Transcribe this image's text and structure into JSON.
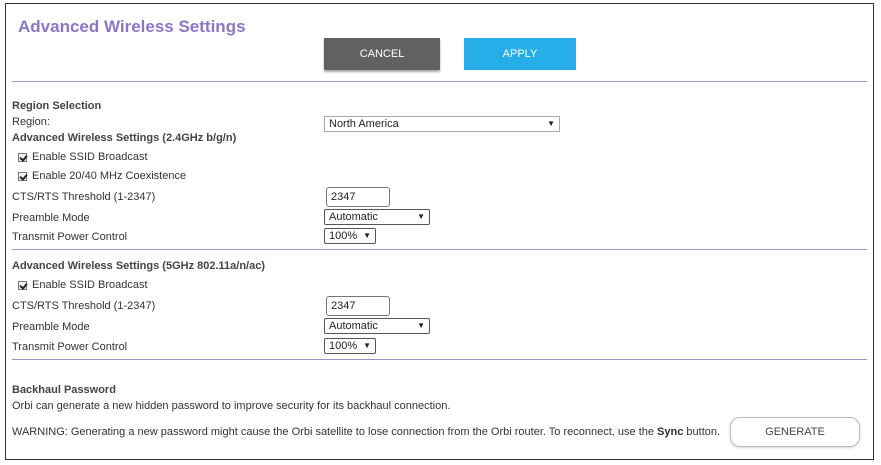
{
  "page": {
    "title": "Advanced Wireless Settings",
    "cancel_label": "CANCEL",
    "apply_label": "APPLY"
  },
  "region": {
    "section_title": "Region Selection",
    "label": "Region:",
    "value": "North America"
  },
  "band_24": {
    "section_title": "Advanced Wireless Settings (2.4GHz b/g/n)",
    "ssid_broadcast_label": "Enable SSID Broadcast",
    "ssid_broadcast_checked": true,
    "coexistence_label": "Enable 20/40 MHz Coexistence",
    "coexistence_checked": true,
    "cts_label": "CTS/RTS Threshold (1-2347)",
    "cts_value": "2347",
    "preamble_label": "Preamble Mode",
    "preamble_value": "Automatic",
    "power_label": "Transmit Power Control",
    "power_value": "100%"
  },
  "band_5": {
    "section_title": "Advanced Wireless Settings (5GHz 802.11a/n/ac)",
    "ssid_broadcast_label": "Enable SSID Broadcast",
    "ssid_broadcast_checked": true,
    "cts_label": "CTS/RTS Threshold (1-2347)",
    "cts_value": "2347",
    "preamble_label": "Preamble Mode",
    "preamble_value": "Automatic",
    "power_label": "Transmit Power Control",
    "power_value": "100%"
  },
  "backhaul": {
    "section_title": "Backhaul Password",
    "description": "Orbi can generate a new hidden password to improve security for its backhaul connection.",
    "warning_prefix": "WARNING: Generating a new password might cause the Orbi satellite to lose connection from the Orbi router. To reconnect, use the ",
    "warning_keyword": "Sync",
    "warning_suffix": " button.",
    "generate_label": "GENERATE"
  },
  "colors": {
    "title": "#8a77c7",
    "cancel_bg": "#616161",
    "apply_bg": "#25aee8",
    "divider": "#9c94c8"
  },
  "icons": {
    "dropdown": "caret-down-icon",
    "checkbox": "checkbox-checked-icon"
  }
}
